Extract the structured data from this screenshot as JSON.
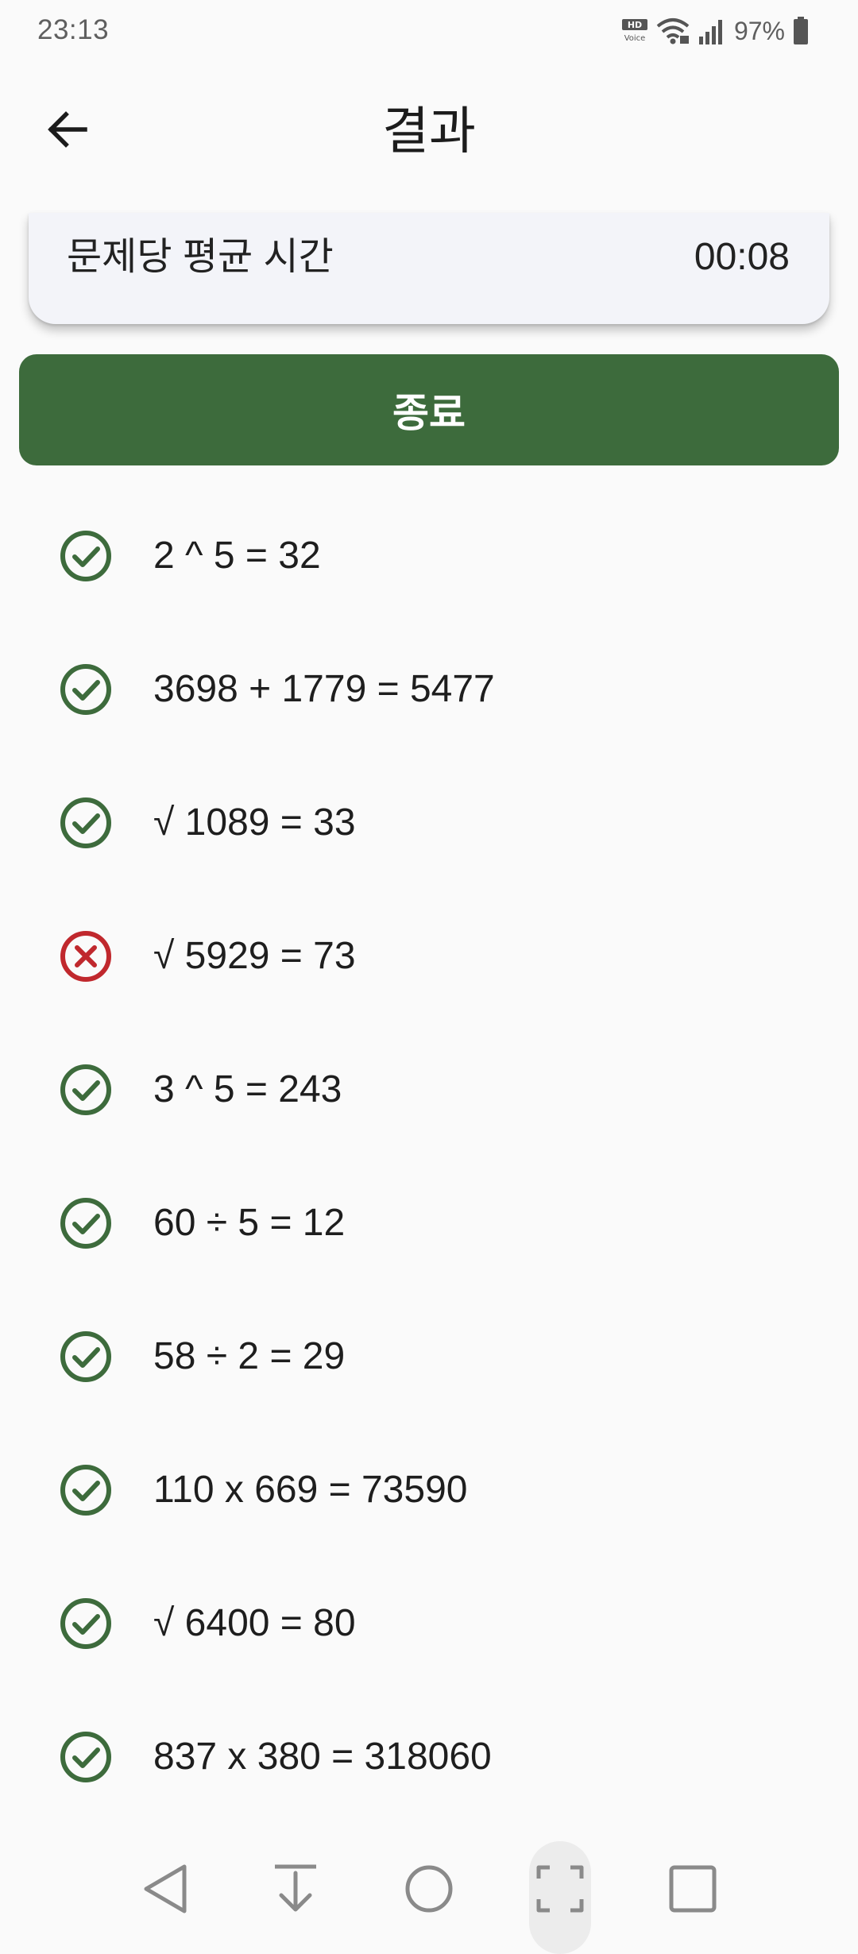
{
  "status_bar": {
    "time": "23:13",
    "battery": "97%",
    "icons": [
      "hd-voice-icon",
      "wifi-icon",
      "signal-icon",
      "battery-icon"
    ]
  },
  "app_bar": {
    "title": "결과",
    "back_icon": "arrow-left-icon"
  },
  "stats": {
    "label": "문제당 평균 시간",
    "value": "00:08"
  },
  "exit_button": {
    "label": "종료"
  },
  "colors": {
    "correct": "#3d6b3c",
    "incorrect": "#c0282d",
    "button": "#3d6b3c"
  },
  "results": [
    {
      "expression": "2 ^ 5 = 32",
      "correct": true
    },
    {
      "expression": "3698 + 1779 = 5477",
      "correct": true
    },
    {
      "expression": "√ 1089 = 33",
      "correct": true
    },
    {
      "expression": "√ 5929 = 73",
      "correct": false
    },
    {
      "expression": "3 ^ 5 = 243",
      "correct": true
    },
    {
      "expression": "60 ÷ 5 = 12",
      "correct": true
    },
    {
      "expression": "58 ÷ 2 = 29",
      "correct": true
    },
    {
      "expression": "110 x 669 = 73590",
      "correct": true
    },
    {
      "expression": "√ 6400 = 80",
      "correct": true
    },
    {
      "expression": "837 x 380 = 318060",
      "correct": true
    }
  ],
  "nav_bar": {
    "buttons": [
      "back-triangle-icon",
      "download-icon",
      "home-circle-icon",
      "screenshot-icon",
      "recents-square-icon"
    ]
  }
}
